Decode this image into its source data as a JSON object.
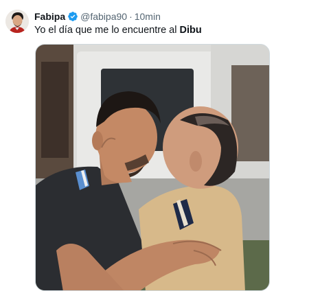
{
  "tweet": {
    "author": {
      "display_name": "Fabipa",
      "handle": "@fabipa90",
      "verified": true,
      "verified_color": "#1d9bf0"
    },
    "separator": "·",
    "timestamp": "10min",
    "text_plain": "Yo el día que me lo encuentre al",
    "text_bold": "Dibu",
    "media": {
      "kind": "photo",
      "description_icon": "photo-icon"
    }
  },
  "colors": {
    "text": "#0f1419",
    "secondary": "#536471",
    "border": "#cfd9de"
  }
}
